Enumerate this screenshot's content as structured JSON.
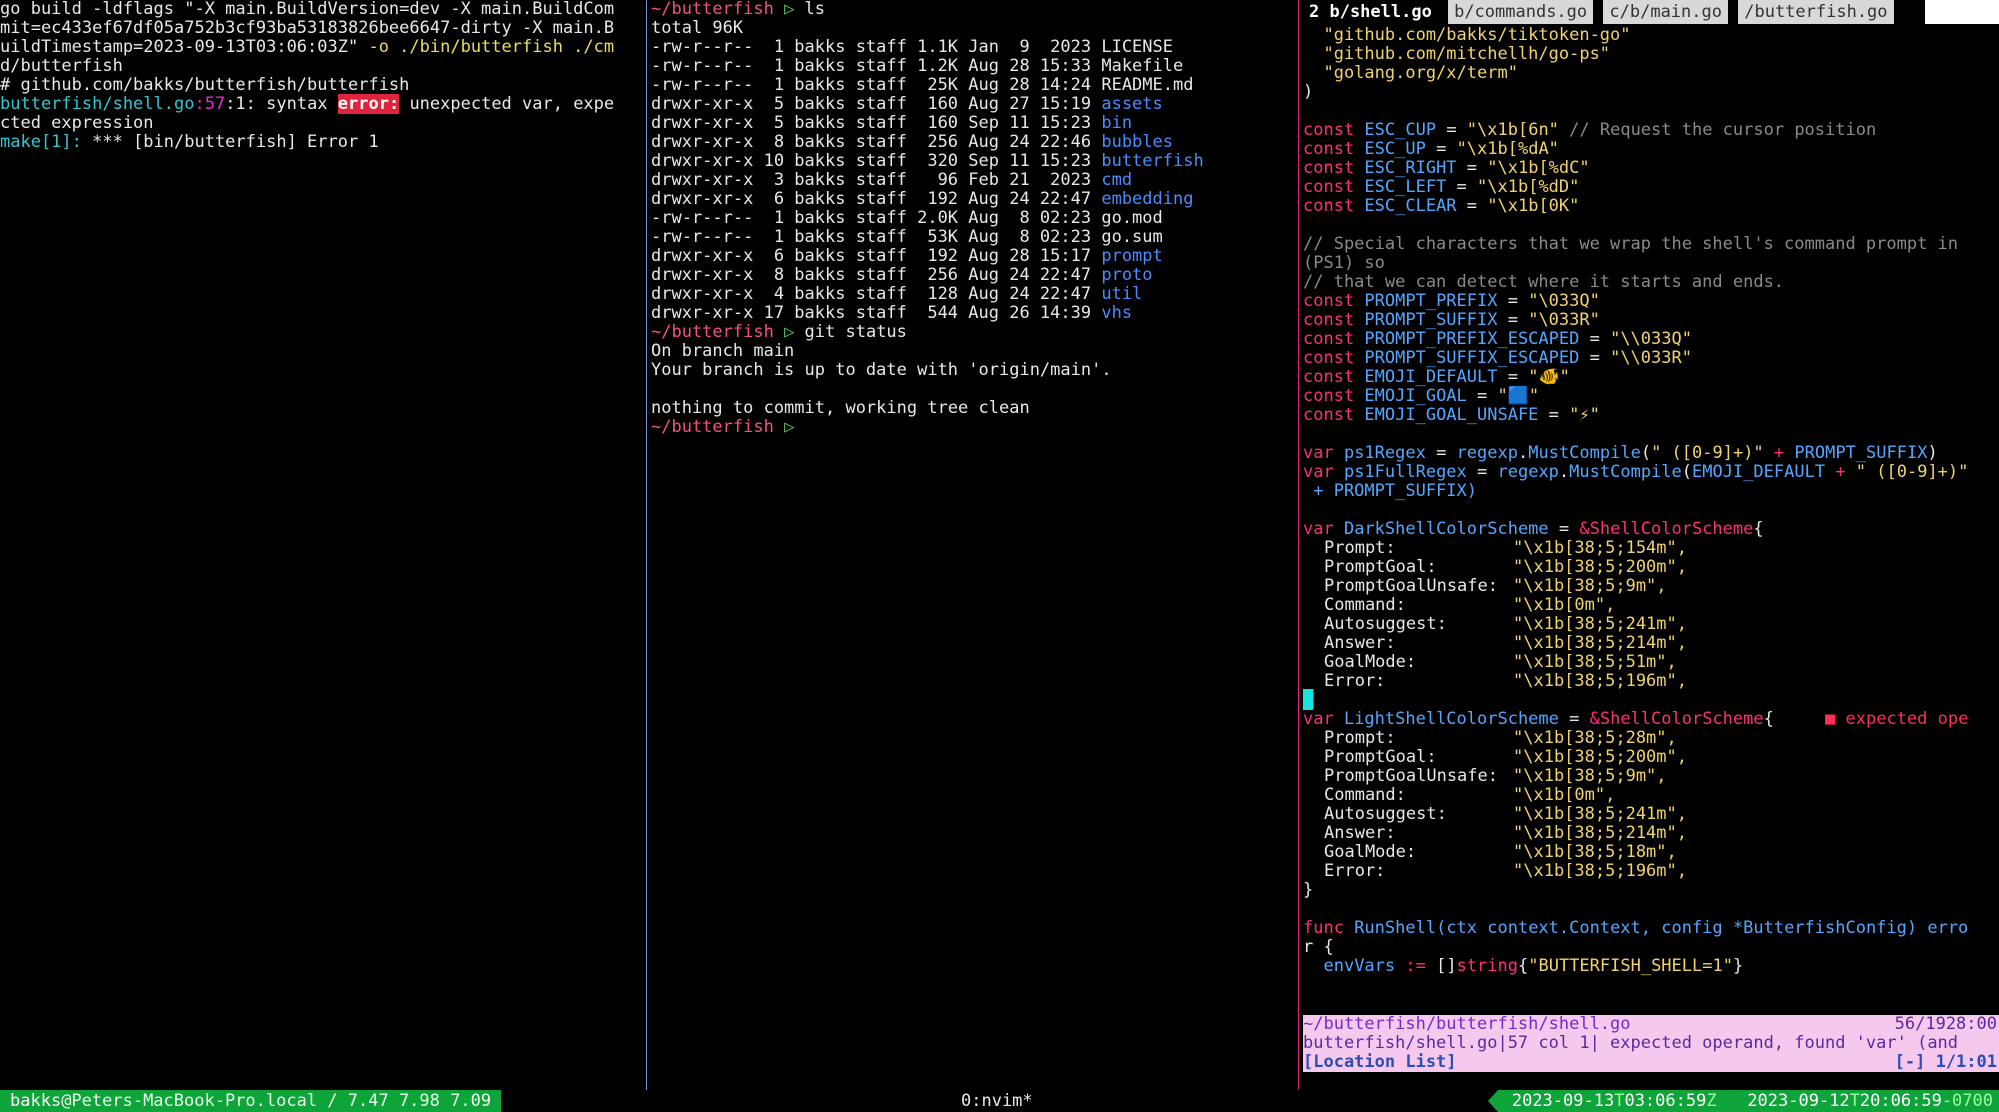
{
  "left_pane": {
    "lines": [
      "go build -ldflags \"-X main.BuildVersion=dev -X main.BuildCom",
      "mit=ec433ef67df05a752b3cf93ba53183826bee6647-dirty -X main.B",
      "uildTimestamp=2023-09-13T03:06:03Z\"",
      "d/butterfish",
      "# github.com/bakks/butterfish/butterfish",
      "",
      "cted expression",
      "",
      ""
    ],
    "build_flags_tail": " -o ./bin/butterfish ./cm",
    "error_file": "butterfish/shell.go",
    "error_pos_line": ":57",
    "error_pos_col": ":1: syntax ",
    "error_tag": "error:",
    "error_msg": " unexpected var, expe",
    "make_prefix": "make[1]:",
    "make_msg": " *** [bin/butterfish] Error 1"
  },
  "middle_pane": {
    "prompt_dir": "~/butterfish",
    "prompt_arrow": " ▷ ",
    "cmd1": "ls",
    "total": "total 96K",
    "listing": [
      {
        "meta": "-rw-r--r--  1 bakks staff 1.1K Jan  9  2023 ",
        "name": "LICENSE",
        "dir": false
      },
      {
        "meta": "-rw-r--r--  1 bakks staff 1.2K Aug 28 15:33 ",
        "name": "Makefile",
        "dir": false
      },
      {
        "meta": "-rw-r--r--  1 bakks staff  25K Aug 28 14:24 ",
        "name": "README.md",
        "dir": false
      },
      {
        "meta": "drwxr-xr-x  5 bakks staff  160 Aug 27 15:19 ",
        "name": "assets",
        "dir": true
      },
      {
        "meta": "drwxr-xr-x  5 bakks staff  160 Sep 11 15:23 ",
        "name": "bin",
        "dir": true
      },
      {
        "meta": "drwxr-xr-x  8 bakks staff  256 Aug 24 22:46 ",
        "name": "bubbles",
        "dir": true
      },
      {
        "meta": "drwxr-xr-x 10 bakks staff  320 Sep 11 15:23 ",
        "name": "butterfish",
        "dir": true
      },
      {
        "meta": "drwxr-xr-x  3 bakks staff   96 Feb 21  2023 ",
        "name": "cmd",
        "dir": true
      },
      {
        "meta": "drwxr-xr-x  6 bakks staff  192 Aug 24 22:47 ",
        "name": "embedding",
        "dir": true
      },
      {
        "meta": "-rw-r--r--  1 bakks staff 2.0K Aug  8 02:23 ",
        "name": "go.mod",
        "dir": false
      },
      {
        "meta": "-rw-r--r--  1 bakks staff  53K Aug  8 02:23 ",
        "name": "go.sum",
        "dir": false
      },
      {
        "meta": "drwxr-xr-x  6 bakks staff  192 Aug 28 15:17 ",
        "name": "prompt",
        "dir": true
      },
      {
        "meta": "drwxr-xr-x  8 bakks staff  256 Aug 24 22:47 ",
        "name": "proto",
        "dir": true
      },
      {
        "meta": "drwxr-xr-x  4 bakks staff  128 Aug 24 22:47 ",
        "name": "util",
        "dir": true
      },
      {
        "meta": "drwxr-xr-x 17 bakks staff  544 Aug 26 14:39 ",
        "name": "vhs",
        "dir": true
      }
    ],
    "cmd2": "git status",
    "git_lines": [
      "On branch main",
      "Your branch is up to date with 'origin/main'.",
      "",
      "nothing to commit, working tree clean"
    ]
  },
  "right_pane": {
    "tabs": [
      {
        "label": "2 b/shell.go",
        "active": true
      },
      {
        "label": "b/commands.go",
        "active": false
      },
      {
        "label": "c/b/main.go",
        "active": false
      },
      {
        "label": "/butterfish.go",
        "active": false
      }
    ],
    "imports": [
      "  \"github.com/bakks/tiktoken-go\"",
      "  \"github.com/mitchellh/go-ps\"",
      "  \"golang.org/x/term\""
    ],
    "close_paren": ")",
    "consts1": [
      {
        "name": "ESC_CUP",
        "val": "\"\\x1b[6n\"",
        "comment": " // Request the cursor position"
      },
      {
        "name": "ESC_UP",
        "val": "\"\\x1b[%dA\"",
        "comment": ""
      },
      {
        "name": "ESC_RIGHT",
        "val": "\"\\x1b[%dC\"",
        "comment": ""
      },
      {
        "name": "ESC_LEFT",
        "val": "\"\\x1b[%dD\"",
        "comment": ""
      },
      {
        "name": "ESC_CLEAR",
        "val": "\"\\x1b[0K\"",
        "comment": ""
      }
    ],
    "comment1": "// Special characters that we wrap the shell's command prompt in",
    "comment1b": "(PS1) so",
    "comment2": "// that we can detect where it starts and ends.",
    "consts2": [
      {
        "name": "PROMPT_PREFIX",
        "val": "\"\\033Q\""
      },
      {
        "name": "PROMPT_SUFFIX",
        "val": "\"\\033R\""
      },
      {
        "name": "PROMPT_PREFIX_ESCAPED",
        "val": "\"\\\\033Q\""
      },
      {
        "name": "PROMPT_SUFFIX_ESCAPED",
        "val": "\"\\\\033R\""
      },
      {
        "name": "EMOJI_DEFAULT",
        "val": "\"🐠\""
      },
      {
        "name": "EMOJI_GOAL",
        "val": "\"🟦\""
      },
      {
        "name": "EMOJI_GOAL_UNSAFE",
        "val": "\"⚡\""
      }
    ],
    "ps1_regex": {
      "name": "ps1Regex",
      "arg": "\" ([0-9]+)\"",
      "suffix": "PROMPT_SUFFIX"
    },
    "ps1_full": {
      "name": "ps1FullRegex",
      "arg1": "EMOJI_DEFAULT",
      "arg2": "\" ([0-9]+)\"",
      "cont": " + PROMPT_SUFFIX)"
    },
    "dark_scheme": {
      "name": "DarkShellColorScheme",
      "type": "&ShellColorScheme",
      "fields": [
        {
          "k": "Prompt:",
          "v": "\"\\x1b[38;5;154m\","
        },
        {
          "k": "PromptGoal:",
          "v": "\"\\x1b[38;5;200m\","
        },
        {
          "k": "PromptGoalUnsafe:",
          "v": "\"\\x1b[38;5;9m\","
        },
        {
          "k": "Command:",
          "v": "\"\\x1b[0m\","
        },
        {
          "k": "Autosuggest:",
          "v": "\"\\x1b[38;5;241m\","
        },
        {
          "k": "Answer:",
          "v": "\"\\x1b[38;5;214m\","
        },
        {
          "k": "GoalMode:",
          "v": "\"\\x1b[38;5;51m\","
        },
        {
          "k": "Error:",
          "v": "\"\\x1b[38;5;196m\","
        }
      ]
    },
    "light_scheme": {
      "name": "LightShellColorScheme",
      "type": "&ShellColorScheme",
      "diagnostic": "■ expected ope",
      "fields": [
        {
          "k": "Prompt:",
          "v": "\"\\x1b[38;5;28m\","
        },
        {
          "k": "PromptGoal:",
          "v": "\"\\x1b[38;5;200m\","
        },
        {
          "k": "PromptGoalUnsafe:",
          "v": "\"\\x1b[38;5;9m\","
        },
        {
          "k": "Command:",
          "v": "\"\\x1b[0m\","
        },
        {
          "k": "Autosuggest:",
          "v": "\"\\x1b[38;5;241m\","
        },
        {
          "k": "Answer:",
          "v": "\"\\x1b[38;5;214m\","
        },
        {
          "k": "GoalMode:",
          "v": "\"\\x1b[38;5;18m\","
        },
        {
          "k": "Error:",
          "v": "\"\\x1b[38;5;196m\","
        }
      ]
    },
    "close_brace": "}",
    "func_line": {
      "name": "RunShell",
      "params": "(ctx context.Context, config *ButterfishConfig) erro"
    },
    "func_line2": "r {",
    "env_line": {
      "name": "envVars",
      "type": "string",
      "val": "\"BUTTERFISH_SHELL=1\""
    },
    "quickfix": {
      "file": "~/butterfish/butterfish/shell.go",
      "pos": "56/1928:00",
      "entry": "butterfish/shell.go|57 col 1| expected operand, found 'var' (and",
      "title": "[Location List]",
      "count": "[-] 1/1:01"
    }
  },
  "status_bar": {
    "user": "bakks",
    "host": "@Peters-MacBook-Pro.local",
    "load": " / 7.47 7.98 7.09",
    "window": "0:nvim*",
    "ts1_date": "2023-09-13",
    "ts1_time": "03:06:59",
    "ts1_zone": "Z",
    "ts2_date": "2023-09-12",
    "ts2_time": "20:06:59",
    "ts2_zone": "-0700"
  },
  "colors": {
    "status_green": "#0ea43a",
    "pane_divider_blue": "#6f8fd6",
    "pane_divider_pink": "#e0207a",
    "quickfix_bg": "#f7c8ee"
  }
}
